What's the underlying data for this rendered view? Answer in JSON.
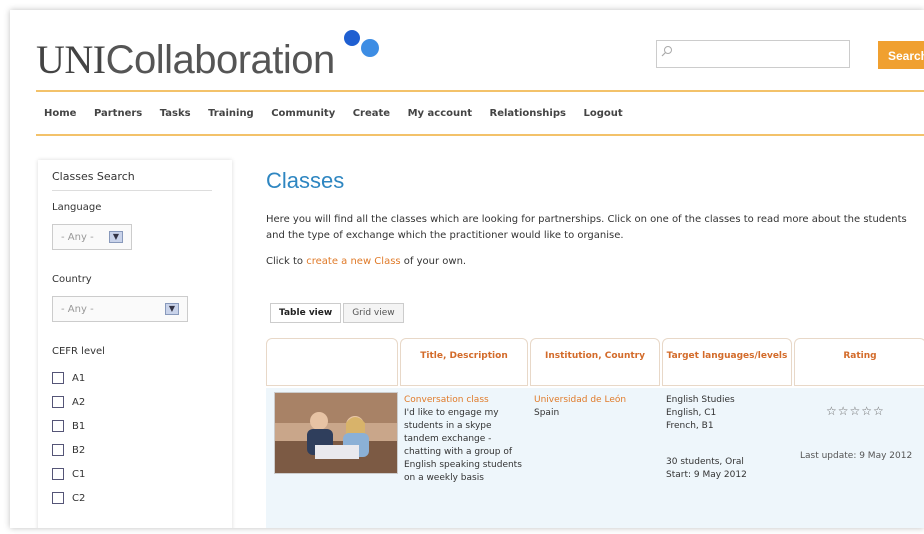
{
  "header": {
    "logo_bold": "UNI",
    "logo_rest": "Collaboration",
    "search_placeholder": "",
    "search_button": "Search"
  },
  "nav": [
    "Home",
    "Partners",
    "Tasks",
    "Training",
    "Community",
    "Create",
    "My account",
    "Relationships",
    "Logout"
  ],
  "sidebar": {
    "title": "Classes Search",
    "language_label": "Language",
    "language_value": "- Any -",
    "country_label": "Country",
    "country_value": "- Any -",
    "cefr_label": "CEFR level",
    "cefr_levels": [
      "A1",
      "A2",
      "B1",
      "B2",
      "C1",
      "C2"
    ]
  },
  "main": {
    "title": "Classes",
    "intro": "Here you will find all the classes which are looking for partnerships. Click on one of the classes to read more about the students and the type of exchange which the practitioner would like to organise.",
    "create_prefix": "Click to ",
    "create_link": "create a new Class",
    "create_suffix": " of your own.",
    "tabs": [
      "Table view",
      "Grid view"
    ],
    "columns": [
      "",
      "Title, Description",
      "Institution, Country",
      "Target languages/levels",
      "Rating"
    ],
    "rows": [
      {
        "title": "Conversation class",
        "description": "I'd like to engage my students in a skype tandem exchange - chatting with a group of English speaking students on a weekly basis",
        "institution": "Universidad de León",
        "country": "Spain",
        "target_1": "English Studies",
        "target_2": "English, C1",
        "target_3": "French, B1",
        "target_4": "30 students, Oral",
        "target_5": "Start: 9 May 2012",
        "stars": "☆☆☆☆☆",
        "last_update": "Last update: 9 May 2012"
      }
    ]
  },
  "colors": {
    "accent_orange": "#e07b2a",
    "title_blue": "#2e86c1",
    "nav_line": "#f3c26a",
    "row_bg": "#eef6fb"
  }
}
